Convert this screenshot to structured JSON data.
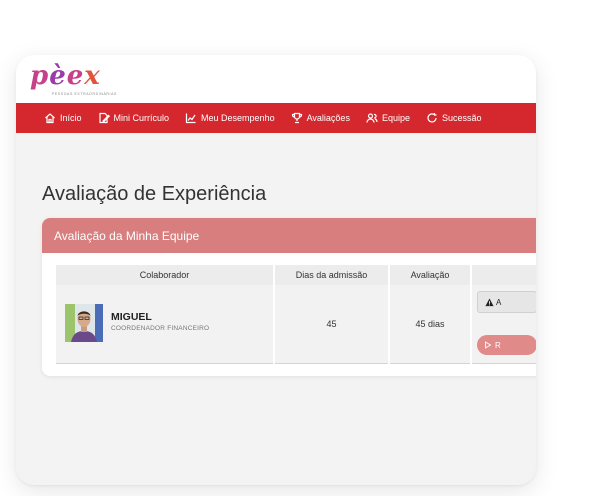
{
  "brand": {
    "logo_text": "pèex",
    "tagline": "pessoas extraordinárias"
  },
  "nav": {
    "items": [
      {
        "label": "Início",
        "icon": "home-icon"
      },
      {
        "label": "Mini Currículo",
        "icon": "document-edit-icon"
      },
      {
        "label": "Meu Desempenho",
        "icon": "chart-line-icon"
      },
      {
        "label": "Avaliações",
        "icon": "trophy-icon"
      },
      {
        "label": "Equipe",
        "icon": "users-icon"
      },
      {
        "label": "Sucessão",
        "icon": "refresh-icon"
      }
    ]
  },
  "page": {
    "title": "Avaliação de Experiência"
  },
  "card": {
    "title": "Avaliação da Minha Equipe",
    "table": {
      "headers": [
        "Colaborador",
        "Dias da admissão",
        "Avaliação",
        ""
      ],
      "rows": [
        {
          "name": "MIGUEL",
          "role": "COORDENADOR FINANCEIRO",
          "days": "45",
          "evaluation": "45 dias",
          "action_primary": "A",
          "action_secondary": "R"
        }
      ]
    }
  },
  "colors": {
    "nav_bg": "#d5282e",
    "card_header_bg": "#d97e7e",
    "secondary_button": "#e18a8a"
  }
}
